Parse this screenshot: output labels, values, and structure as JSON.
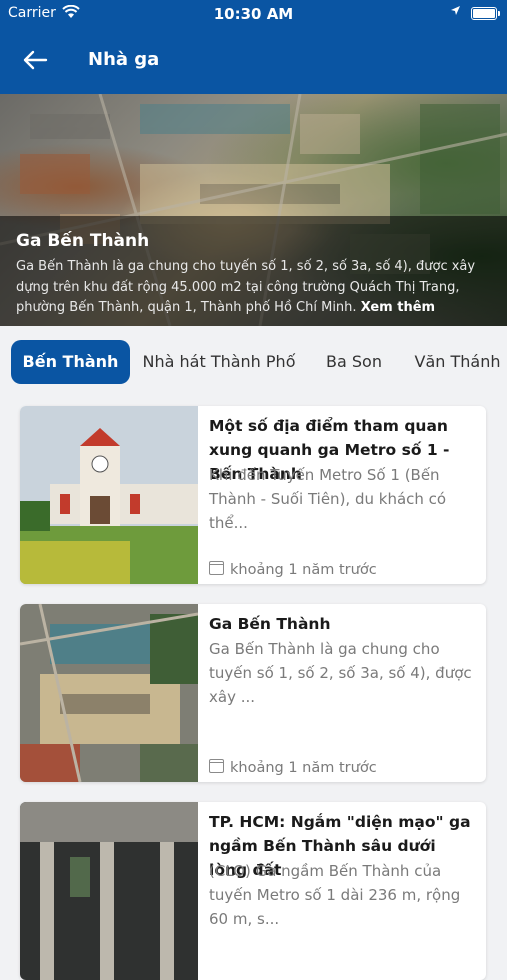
{
  "status_bar": {
    "carrier": "Carrier",
    "time": "10:30 AM"
  },
  "header": {
    "title": "Nhà ga",
    "back_icon": "back-arrow-icon"
  },
  "hero": {
    "title": "Ga Bến Thành",
    "description": "Ga Bến Thành  là ga chung cho tuyến số 1, số 2, số 3a, số 4), được xây dựng trên khu đất rộng 45.000 m2 tại công trường Quách Thị Trang, phường Bến Thành, quận 1, Thành phố Hồ Chí Minh.",
    "more_label": "Xem thêm"
  },
  "tabs": [
    {
      "label": "Bến Thành",
      "active": true
    },
    {
      "label": "Nhà hát Thành Phố",
      "active": false
    },
    {
      "label": "Ba Son",
      "active": false
    },
    {
      "label": "Văn Thánh",
      "active": false
    }
  ],
  "articles": [
    {
      "title": "Một số địa điểm tham quan xung quanh ga Metro số 1 - Bến Thành",
      "description": "Khi đến Tuyến Metro Số 1 (Bến Thành - Suối Tiên), du khách có thể...",
      "date": "khoảng 1 năm trước"
    },
    {
      "title": "Ga Bến Thành",
      "description": "Ga Bến Thành  là ga chung cho tuyến số 1, số 2, số 3a, số 4), được xây ...",
      "date": "khoảng 1 năm trước"
    },
    {
      "title": "TP. HCM: Ngắm \"diện mạo\" ga ngầm Bến Thành sâu dưới lòng đất",
      "description": "(CLO) Ga ngầm Bến Thành của tuyến Metro số 1 dài 236 m, rộng 60 m, s...",
      "date": ""
    }
  ],
  "colors": {
    "primary": "#0a55a3",
    "background": "#f1f2f4"
  }
}
